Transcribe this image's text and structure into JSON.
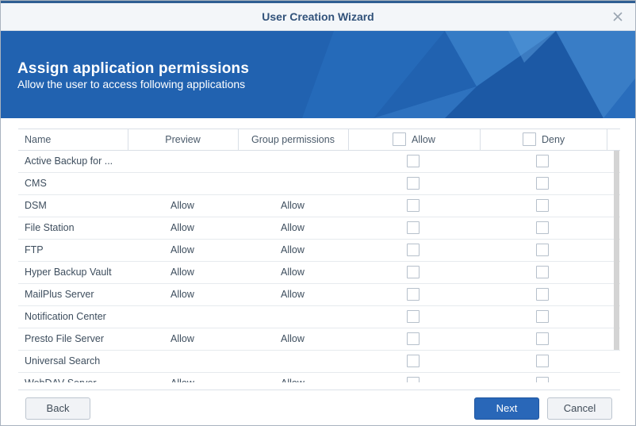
{
  "window": {
    "title": "User Creation Wizard"
  },
  "banner": {
    "title": "Assign application permissions",
    "subtitle": "Allow the user to access following applications"
  },
  "table": {
    "columns": {
      "name": "Name",
      "preview": "Preview",
      "group": "Group permissions",
      "allow": "Allow",
      "deny": "Deny"
    },
    "rows": [
      {
        "name": "Active Backup for ...",
        "preview": "",
        "group": ""
      },
      {
        "name": "CMS",
        "preview": "",
        "group": ""
      },
      {
        "name": "DSM",
        "preview": "Allow",
        "group": "Allow"
      },
      {
        "name": "File Station",
        "preview": "Allow",
        "group": "Allow"
      },
      {
        "name": "FTP",
        "preview": "Allow",
        "group": "Allow"
      },
      {
        "name": "Hyper Backup Vault",
        "preview": "Allow",
        "group": "Allow"
      },
      {
        "name": "MailPlus Server",
        "preview": "Allow",
        "group": "Allow"
      },
      {
        "name": "Notification Center",
        "preview": "",
        "group": ""
      },
      {
        "name": "Presto File Server",
        "preview": "Allow",
        "group": "Allow"
      },
      {
        "name": "Universal Search",
        "preview": "",
        "group": ""
      },
      {
        "name": "WebDAV Server",
        "preview": "Allow",
        "group": "Allow"
      }
    ]
  },
  "footer": {
    "back": "Back",
    "next": "Next",
    "cancel": "Cancel"
  },
  "colors": {
    "accent": "#2967b8",
    "title": "#31527a",
    "banner": "#2162b0"
  },
  "icons": {
    "close": "close-icon",
    "checkbox": "checkbox-icon"
  }
}
